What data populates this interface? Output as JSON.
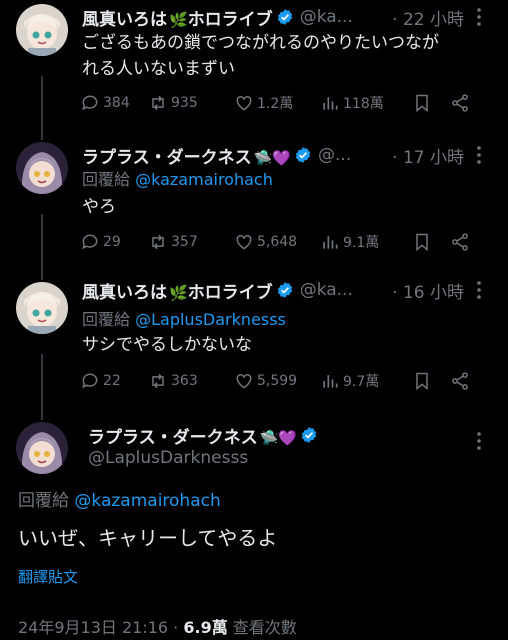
{
  "colors": {
    "accent": "#1d9bf0",
    "text": "#e7e9ea",
    "muted": "#71767b",
    "verified": "#1d9bf0",
    "background": "#000000"
  },
  "tweets": [
    {
      "name": "風真いろは🌿ホロライブ",
      "name_main": "風真いろは",
      "name_emoji": "🌿",
      "name_tail": "ホロライブ",
      "handle": "@ka...",
      "time": "· 22 小時",
      "text_line1": "ござるもあの鎖でつながれるのやりたいつなが",
      "text_line2": "れる人いないまずい",
      "replies": "384",
      "retweets": "935",
      "likes": "1.2萬",
      "views": "118萬"
    },
    {
      "name": "ラプラス・ダークネス🛸💜",
      "name_main": "ラプラス・ダークネス",
      "name_emoji": "🛸💜",
      "handle": "@...",
      "time": "· 17 小時",
      "reply_prefix": "回覆給",
      "reply_mention": "@kazamairohach",
      "text_line1": "やろ",
      "replies": "29",
      "retweets": "357",
      "likes": "5,648",
      "views": "9.1萬"
    },
    {
      "name": "風真いろは🌿ホロライブ",
      "name_main": "風真いろは",
      "name_emoji": "🌿",
      "name_tail": "ホロライブ",
      "handle": "@ka...",
      "time": "· 16 小時",
      "reply_prefix": "回覆給",
      "reply_mention": "@LaplusDarknesss",
      "text_line1": "サシでやるしかないな",
      "replies": "22",
      "retweets": "363",
      "likes": "5,599",
      "views": "9.7萬"
    }
  ],
  "focal": {
    "name_main": "ラプラス・ダークネス",
    "name_emoji": "🛸💜",
    "handle": "@LaplusDarknesss",
    "reply_prefix": "回覆給",
    "reply_mention": "@kazamairohach",
    "text": "いいぜ、キャリーしてやるよ",
    "translate": "翻譯貼文",
    "date": "24年9月13日 21:16 · ",
    "views_count": "6.9萬",
    "views_label": " 查看次數"
  }
}
